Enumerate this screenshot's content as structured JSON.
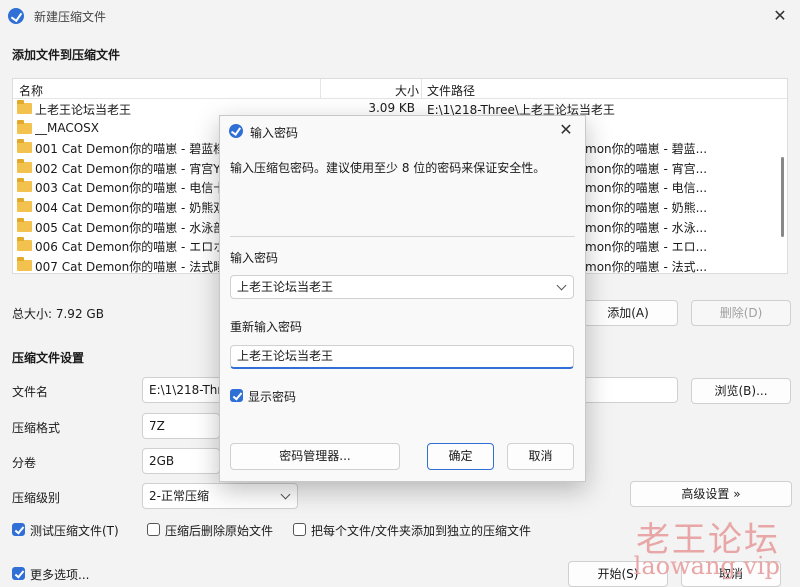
{
  "window": {
    "title": "新建压缩文件"
  },
  "sections": {
    "add_files": "添加文件到压缩文件",
    "settings": "压缩文件设置"
  },
  "file_list": {
    "headers": {
      "name": "名称",
      "size": "大小",
      "path": "文件路径"
    },
    "rows": [
      {
        "name": "上老王论坛当老王",
        "size": "3.09 KB",
        "path": "E:\\1\\218-Three\\上老王论坛当老王"
      },
      {
        "name": "__MACOSX",
        "size": "",
        "path": ""
      },
      {
        "name": "001 Cat Demon你的喵崽 - 碧蓝档案",
        "size": "",
        "path": "mon你的喵崽 - 碧蓝..."
      },
      {
        "name": "002 Cat Demon你的喵崽 - 宵宫YC",
        "size": "",
        "path": "mon你的喵崽 - 宵宫..."
      },
      {
        "name": "003 Cat Demon你的喵崽 - 电信十",
        "size": "",
        "path": "mon你的喵崽 - 电信..."
      },
      {
        "name": "004 Cat Demon你的喵崽 - 奶熊双",
        "size": "",
        "path": "mon你的喵崽 - 奶熊..."
      },
      {
        "name": "005 Cat Demon你的喵崽 - 水泳部",
        "size": "",
        "path": "mon你的喵崽 - 水泳..."
      },
      {
        "name": "006 Cat Demon你的喵崽 - エロホ",
        "size": "",
        "path": "mon你的喵崽 - エロ..."
      },
      {
        "name": "007 Cat Demon你的喵崽 - 法式睡",
        "size": "",
        "path": "mon你的喵崽 - 法式..."
      }
    ]
  },
  "total_size": "总大小: 7.92 GB",
  "buttons": {
    "add": "添加(A)",
    "delete": "删除(D)",
    "browse": "浏览(B)...",
    "advanced": "高级设置 »",
    "start": "开始(S)",
    "cancel_main": "取消"
  },
  "settings": {
    "filename_label": "文件名",
    "filename_value": "E:\\1\\218-Thr",
    "format_label": "压缩格式",
    "format_value": "7Z",
    "volume_label": "分卷",
    "volume_value": "2GB",
    "level_label": "压缩级别",
    "level_value": "2-正常压缩"
  },
  "checkboxes": {
    "test": {
      "label": "测试压缩文件(T)",
      "checked": true
    },
    "delete_after": {
      "label": "压缩后删除原始文件",
      "checked": false
    },
    "each_separate": {
      "label": "把每个文件/文件夹添加到独立的压缩文件",
      "checked": false
    },
    "more_options": {
      "label": "更多选项...",
      "checked": true
    }
  },
  "watermark": {
    "line1": "老王论坛",
    "line2": "laowang.vip"
  },
  "dialog": {
    "title": "输入密码",
    "description": "输入压缩包密码。建议使用至少 8 位的密码来保证安全性。",
    "password_label": "输入密码",
    "password_value": "上老王论坛当老王",
    "reenter_label": "重新输入密码",
    "reenter_value": "上老王论坛当老王",
    "show_password": {
      "label": "显示密码",
      "checked": true
    },
    "manager_button": "密码管理器...",
    "ok_button": "确定",
    "cancel_button": "取消"
  },
  "colors": {
    "accent": "#2f6fd6",
    "folder": "#f2c14e",
    "watermark": "#e8a6a6"
  }
}
